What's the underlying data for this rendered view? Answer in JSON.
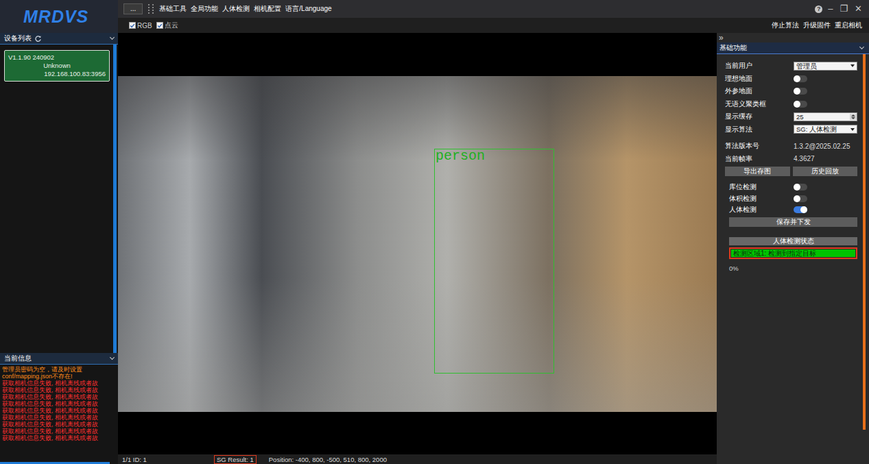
{
  "app": {
    "logo": "MRDVS"
  },
  "device_list": {
    "title": "设备列表",
    "devices": [
      {
        "version": "V1.1.90 240902",
        "name": "Unknown",
        "address": "192.168.100.83:3956",
        "selected": true
      }
    ]
  },
  "messages": {
    "title": "当前信息",
    "lines": [
      {
        "text": "管理员密码为空，请及时设置",
        "color": "#ff8c1a"
      },
      {
        "text": "conf/mapping.json不存在!",
        "color": "#ff8c1a"
      },
      {
        "text": "获取相机信息失败, 相机离线或者故",
        "color": "#ff3030"
      },
      {
        "text": "获取相机信息失败, 相机离线或者故",
        "color": "#ff3030"
      },
      {
        "text": "获取相机信息失败, 相机离线或者故",
        "color": "#ff3030"
      },
      {
        "text": "获取相机信息失败, 相机离线或者故",
        "color": "#ff3030"
      },
      {
        "text": "获取相机信息失败, 相机离线或者故",
        "color": "#ff3030"
      },
      {
        "text": "获取相机信息失败, 相机离线或者故",
        "color": "#ff3030"
      },
      {
        "text": "获取相机信息失败, 相机离线或者故",
        "color": "#ff3030"
      },
      {
        "text": "获取相机信息失败, 相机离线或者故",
        "color": "#ff3030"
      },
      {
        "text": "获取相机信息失败, 相机离线或者故",
        "color": "#ff3030"
      }
    ]
  },
  "menu": {
    "button": "...",
    "items": [
      "基础工具",
      "全局功能",
      "人体检测",
      "相机配置",
      "语言/Language"
    ]
  },
  "window_controls": [
    "?",
    "–",
    "❐",
    "✕"
  ],
  "view_toggles": [
    {
      "label": "RGB",
      "checked": true
    },
    {
      "label": "点云",
      "checked": true
    }
  ],
  "actions": [
    "停止算法",
    "升级固件",
    "重启相机"
  ],
  "viewport": {
    "detections": [
      {
        "label": "person"
      }
    ]
  },
  "status_bar": {
    "frame": "1/1 ID: 1",
    "result": "SG Result: 1",
    "position": "Position: -400, 800, -500, 510, 800, 2000"
  },
  "panel": {
    "collapse": "»",
    "title": "基础功能",
    "settings": [
      {
        "kind": "select",
        "label": "当前用户",
        "value": "管理员"
      },
      {
        "kind": "toggle",
        "label": "理想地面",
        "on": false
      },
      {
        "kind": "toggle",
        "label": "外参地面",
        "on": false
      },
      {
        "kind": "toggle",
        "label": "无语义聚类框",
        "on": false
      },
      {
        "kind": "number",
        "label": "显示缓存",
        "value": "25"
      },
      {
        "kind": "select",
        "label": "显示算法",
        "value": "SG: 人体检测"
      }
    ],
    "info": [
      {
        "label": "算法版本号",
        "value": "1.3.2@2025.02.25"
      },
      {
        "label": "当前帧率",
        "value": "4.3627"
      }
    ],
    "buttons": [
      "导出存图",
      "历史回放"
    ],
    "features": [
      {
        "label": "库位检测",
        "on": false
      },
      {
        "label": "体积检测",
        "on": false
      },
      {
        "label": "人体检测",
        "on": true
      }
    ],
    "save": "保存并下发",
    "status": {
      "title": "人体检测状态",
      "items": [
        {
          "text": "检测区域1: 检测到指定目标",
          "color": "#00c400",
          "highlighted": true
        }
      ],
      "progress": "0%"
    }
  }
}
